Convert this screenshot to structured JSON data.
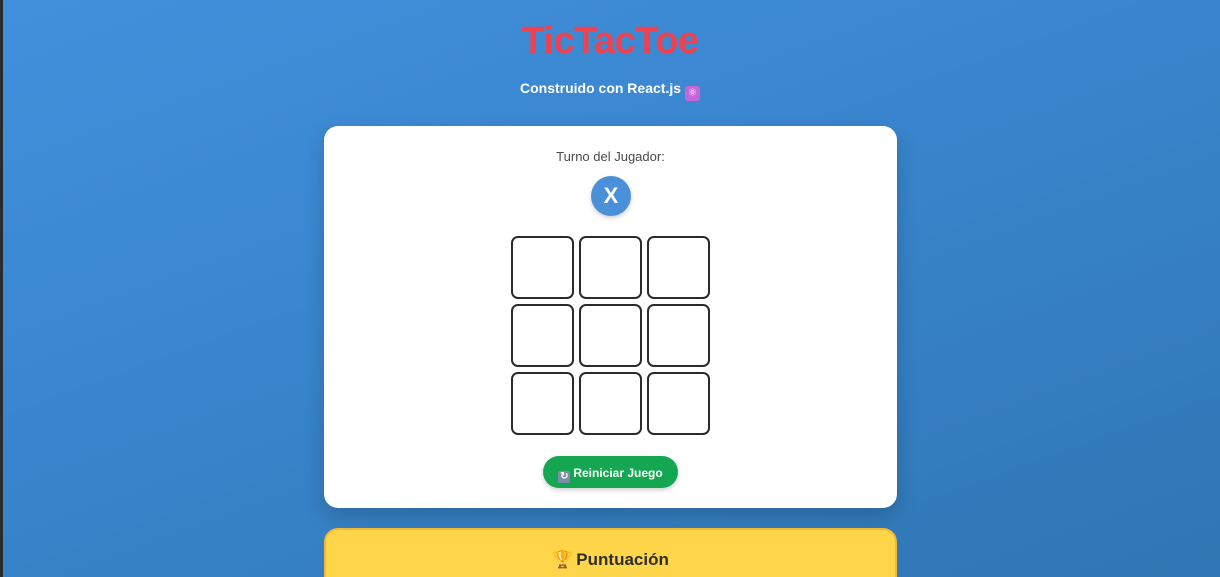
{
  "header": {
    "title": "TicTacToe",
    "subtitle": "Construido con React.js",
    "subtitle_icon": "react-atom-icon"
  },
  "game": {
    "turn_label": "Turno del Jugador:",
    "current_player": "X",
    "board": [
      "",
      "",
      "",
      "",
      "",
      "",
      "",
      "",
      ""
    ],
    "reset_label": "Reiniciar Juego",
    "reset_icon": "refresh-icon"
  },
  "score": {
    "title": "Puntuación",
    "title_icon": "trophy-icon"
  },
  "colors": {
    "background": "#3a86cf",
    "title": "#f0414f",
    "player_token": "#4a90d9",
    "reset_button": "#14a650",
    "score_card": "#ffd54a"
  }
}
